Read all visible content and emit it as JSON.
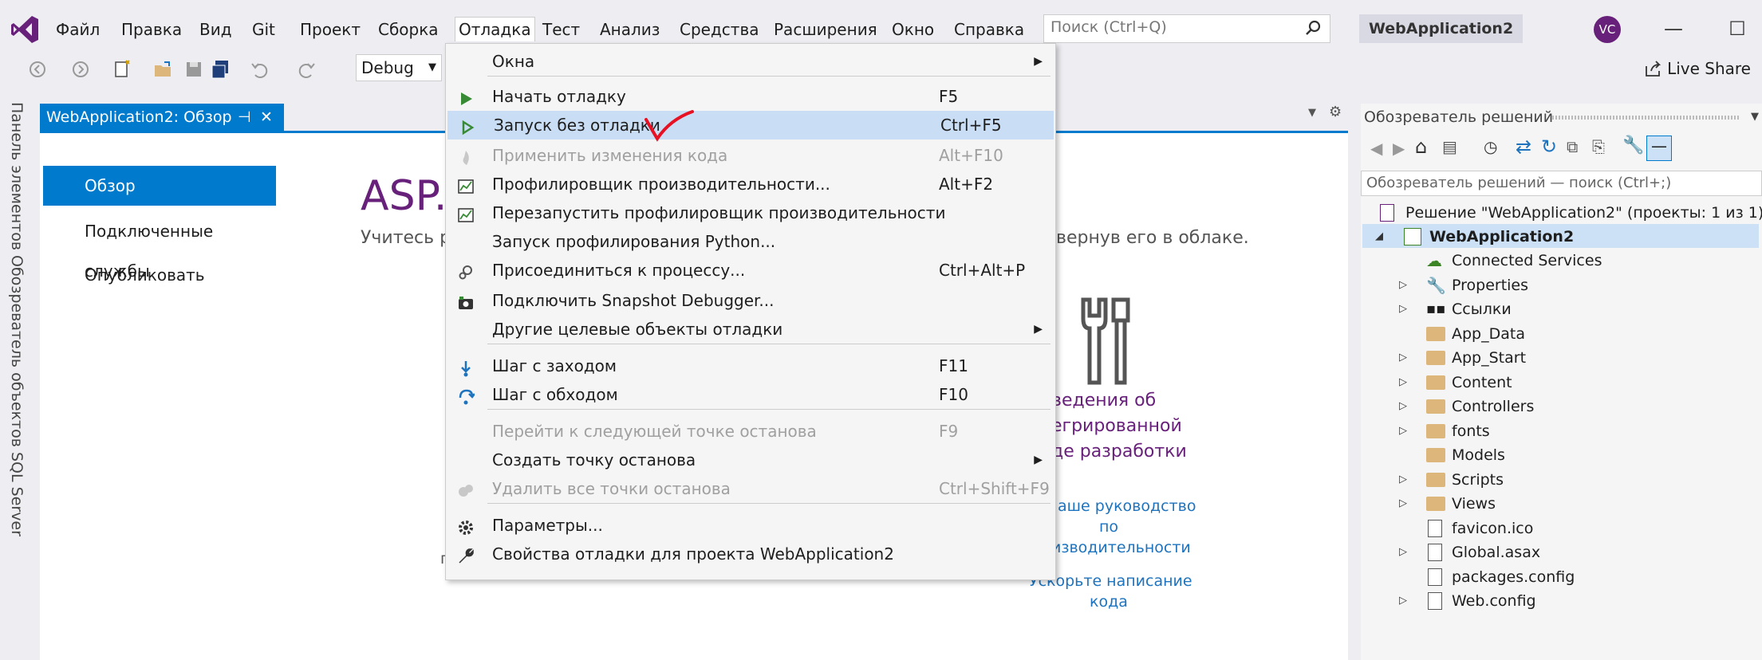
{
  "menubar": {
    "items": [
      "Файл",
      "Правка",
      "Вид",
      "Git",
      "Проект",
      "Сборка",
      "Отладка",
      "Тест",
      "Анализ",
      "Средства",
      "Расширения",
      "Окно",
      "Справка"
    ],
    "search_placeholder": "Поиск (Ctrl+Q)",
    "solution_name": "WebApplication2",
    "avatar_initials": "VC",
    "minimize": "—",
    "maximize": "☐"
  },
  "toolbar": {
    "config": "Debug",
    "live_share": "Live Share"
  },
  "side_tabs": {
    "toolbox": "Панель элементов",
    "sql_explorer": "Обозреватель объектов SQL Server"
  },
  "document": {
    "tab_label": "WebApplication2: Обзор",
    "nav": [
      "Обзор",
      "Подключенные службы",
      "Опубликовать"
    ],
    "title": "ASP.I",
    "subtitle_left": "Учитесь р",
    "subtitle_right": "вернув его в облаке.",
    "panel_text": [
      "ведения об",
      "егрированной",
      "де разработки"
    ],
    "link1": [
      "аше руководство",
      "по",
      "изводительности"
    ],
    "link2": [
      "Ускорьте написание",
      "кода"
    ],
    "stray_char": "п"
  },
  "debug_menu": {
    "items": [
      {
        "label": "Окна",
        "shortcut": "",
        "submenu": true,
        "disabled": false,
        "icon": ""
      },
      {
        "label": "Начать отладку",
        "shortcut": "F5",
        "submenu": false,
        "disabled": false,
        "icon": "play-icon"
      },
      {
        "label": "Запуск без отладки",
        "shortcut": "Ctrl+F5",
        "submenu": false,
        "disabled": false,
        "icon": "play-outline-icon",
        "highlighted": true
      },
      {
        "label": "Применить изменения кода",
        "shortcut": "Alt+F10",
        "submenu": false,
        "disabled": true,
        "icon": "hot-reload-icon"
      },
      {
        "label": "Профилировщик производительности...",
        "shortcut": "Alt+F2",
        "submenu": false,
        "disabled": false,
        "icon": "profiler-icon"
      },
      {
        "label": "Перезапустить профилировщик производительности",
        "shortcut": "",
        "submenu": false,
        "disabled": false,
        "icon": "profiler-restart-icon"
      },
      {
        "label": "Запуск профилирования Python...",
        "shortcut": "",
        "submenu": false,
        "disabled": false,
        "icon": ""
      },
      {
        "label": "Присоединиться к процессу...",
        "shortcut": "Ctrl+Alt+P",
        "submenu": false,
        "disabled": false,
        "icon": "attach-icon"
      },
      {
        "label": "Подключить Snapshot Debugger...",
        "shortcut": "",
        "submenu": false,
        "disabled": false,
        "icon": "camera-icon"
      },
      {
        "label": "Другие целевые объекты отладки",
        "shortcut": "",
        "submenu": true,
        "disabled": false,
        "icon": ""
      },
      {
        "label": "Шаг с заходом",
        "shortcut": "F11",
        "submenu": false,
        "disabled": false,
        "icon": "step-into-icon"
      },
      {
        "label": "Шаг с обходом",
        "shortcut": "F10",
        "submenu": false,
        "disabled": false,
        "icon": "step-over-icon"
      },
      {
        "label": "Перейти к следующей точке останова",
        "shortcut": "F9",
        "submenu": false,
        "disabled": true,
        "icon": ""
      },
      {
        "label": "Создать точку останова",
        "shortcut": "",
        "submenu": true,
        "disabled": false,
        "icon": ""
      },
      {
        "label": "Удалить все точки останова",
        "shortcut": "Ctrl+Shift+F9",
        "submenu": false,
        "disabled": true,
        "icon": "delete-breakpoints-icon"
      },
      {
        "label": "Параметры...",
        "shortcut": "",
        "submenu": false,
        "disabled": false,
        "icon": "gear-icon"
      },
      {
        "label": "Свойства отладки для проекта WebApplication2",
        "shortcut": "",
        "submenu": false,
        "disabled": false,
        "icon": "wrench-icon"
      }
    ]
  },
  "solution_explorer": {
    "title": "Обозреватель решений",
    "search_placeholder": "Обозреватель решений — поиск (Ctrl+;)",
    "solution": "Решение \"WebApplication2\" (проекты: 1 из 1)",
    "project": "WebApplication2",
    "nodes": [
      {
        "label": "Connected Services",
        "expander": false,
        "type": "service"
      },
      {
        "label": "Properties",
        "expander": true,
        "type": "wrench"
      },
      {
        "label": "Ссылки",
        "expander": true,
        "type": "refs"
      },
      {
        "label": "App_Data",
        "expander": false,
        "type": "folder"
      },
      {
        "label": "App_Start",
        "expander": true,
        "type": "folder"
      },
      {
        "label": "Content",
        "expander": true,
        "type": "folder"
      },
      {
        "label": "Controllers",
        "expander": true,
        "type": "folder"
      },
      {
        "label": "fonts",
        "expander": true,
        "type": "folder"
      },
      {
        "label": "Models",
        "expander": false,
        "type": "folder"
      },
      {
        "label": "Scripts",
        "expander": true,
        "type": "folder"
      },
      {
        "label": "Views",
        "expander": true,
        "type": "folder"
      },
      {
        "label": "favicon.ico",
        "expander": false,
        "type": "file"
      },
      {
        "label": "Global.asax",
        "expander": true,
        "type": "file"
      },
      {
        "label": "packages.config",
        "expander": false,
        "type": "file"
      },
      {
        "label": "Web.config",
        "expander": true,
        "type": "file"
      }
    ]
  }
}
